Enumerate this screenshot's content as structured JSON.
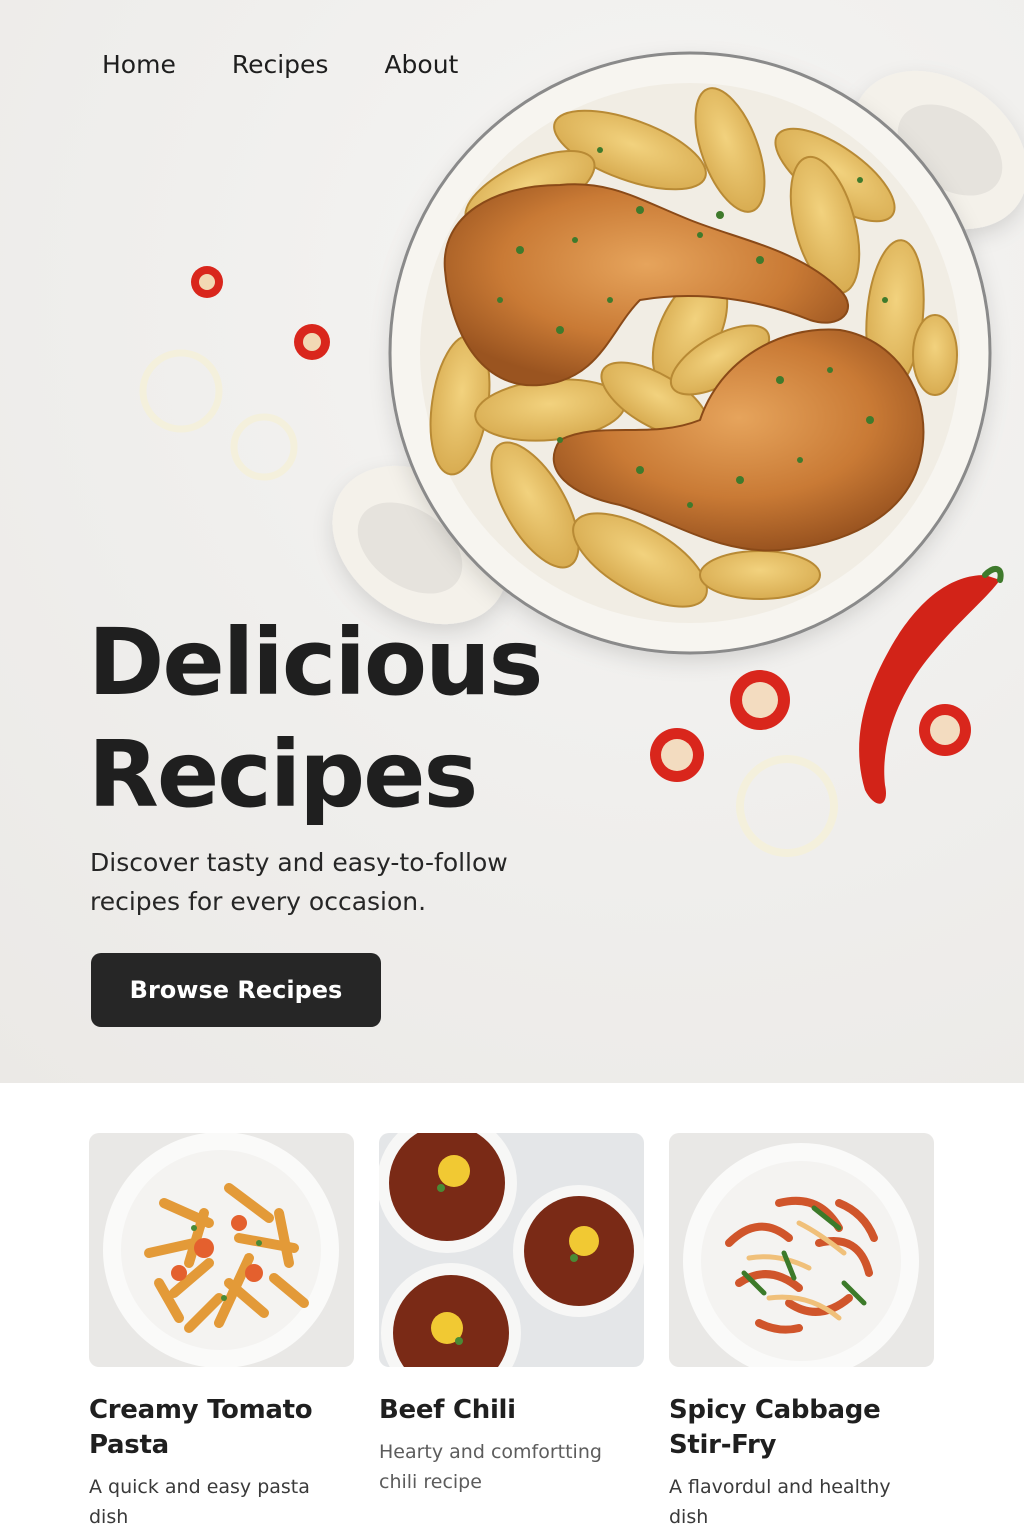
{
  "nav": {
    "items": [
      {
        "label": "Home"
      },
      {
        "label": "Recipes"
      },
      {
        "label": "About"
      }
    ]
  },
  "hero": {
    "title_line1": "Delicious",
    "title_line2": "Recipes",
    "subtitle": "Discover tasty and easy-to-follow recipes for every occasion.",
    "cta_label": "Browse Recipes",
    "image_icon": "roast-chicken-potatoes-image"
  },
  "recipes": [
    {
      "title": "Creamy Tomato Pasta",
      "description": "A quick and easy pasta dish",
      "image_icon": "pasta-bowl-image"
    },
    {
      "title": "Beef Chili",
      "description": "Hearty and comfortting chili recipe",
      "image_icon": "chili-bowls-image"
    },
    {
      "title": "Spicy Cabbage Stir-Fry",
      "description": "A flavordul and healthy dish",
      "image_icon": "cabbage-stirfry-image"
    }
  ],
  "colors": {
    "hero_background": "#efeeec",
    "button_background": "#262626",
    "button_text": "#ffffff",
    "text_primary": "#1f1f1f",
    "text_secondary": "#5c5c5c",
    "accent_red": "#d9261c"
  }
}
